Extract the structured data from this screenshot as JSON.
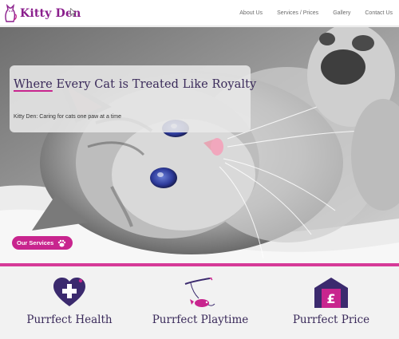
{
  "brand": {
    "name": "Kitty Den"
  },
  "nav": {
    "items": [
      "About Us",
      "Services / Prices",
      "Gallery",
      "Contact Us"
    ]
  },
  "hero": {
    "headline_lead": "Where",
    "headline_rest": " Every Cat is Treated Like Royalty",
    "subtitle": "Kitty Den: Caring for cats one paw at a time",
    "cta_label": "Our Services"
  },
  "features": [
    {
      "title": "Purrfect Health",
      "icon": "heart-cross-icon",
      "desc": ""
    },
    {
      "title": "Purrfect Playtime",
      "icon": "cat-toy-wand-icon",
      "desc": ""
    },
    {
      "title": "Purrfect Price",
      "icon": "pound-house-icon",
      "desc": ""
    }
  ],
  "colors": {
    "brand": "#8a1e8c",
    "accent": "#c8258e",
    "heading": "#3a2a5a",
    "icon_dark": "#3b2a6e"
  }
}
